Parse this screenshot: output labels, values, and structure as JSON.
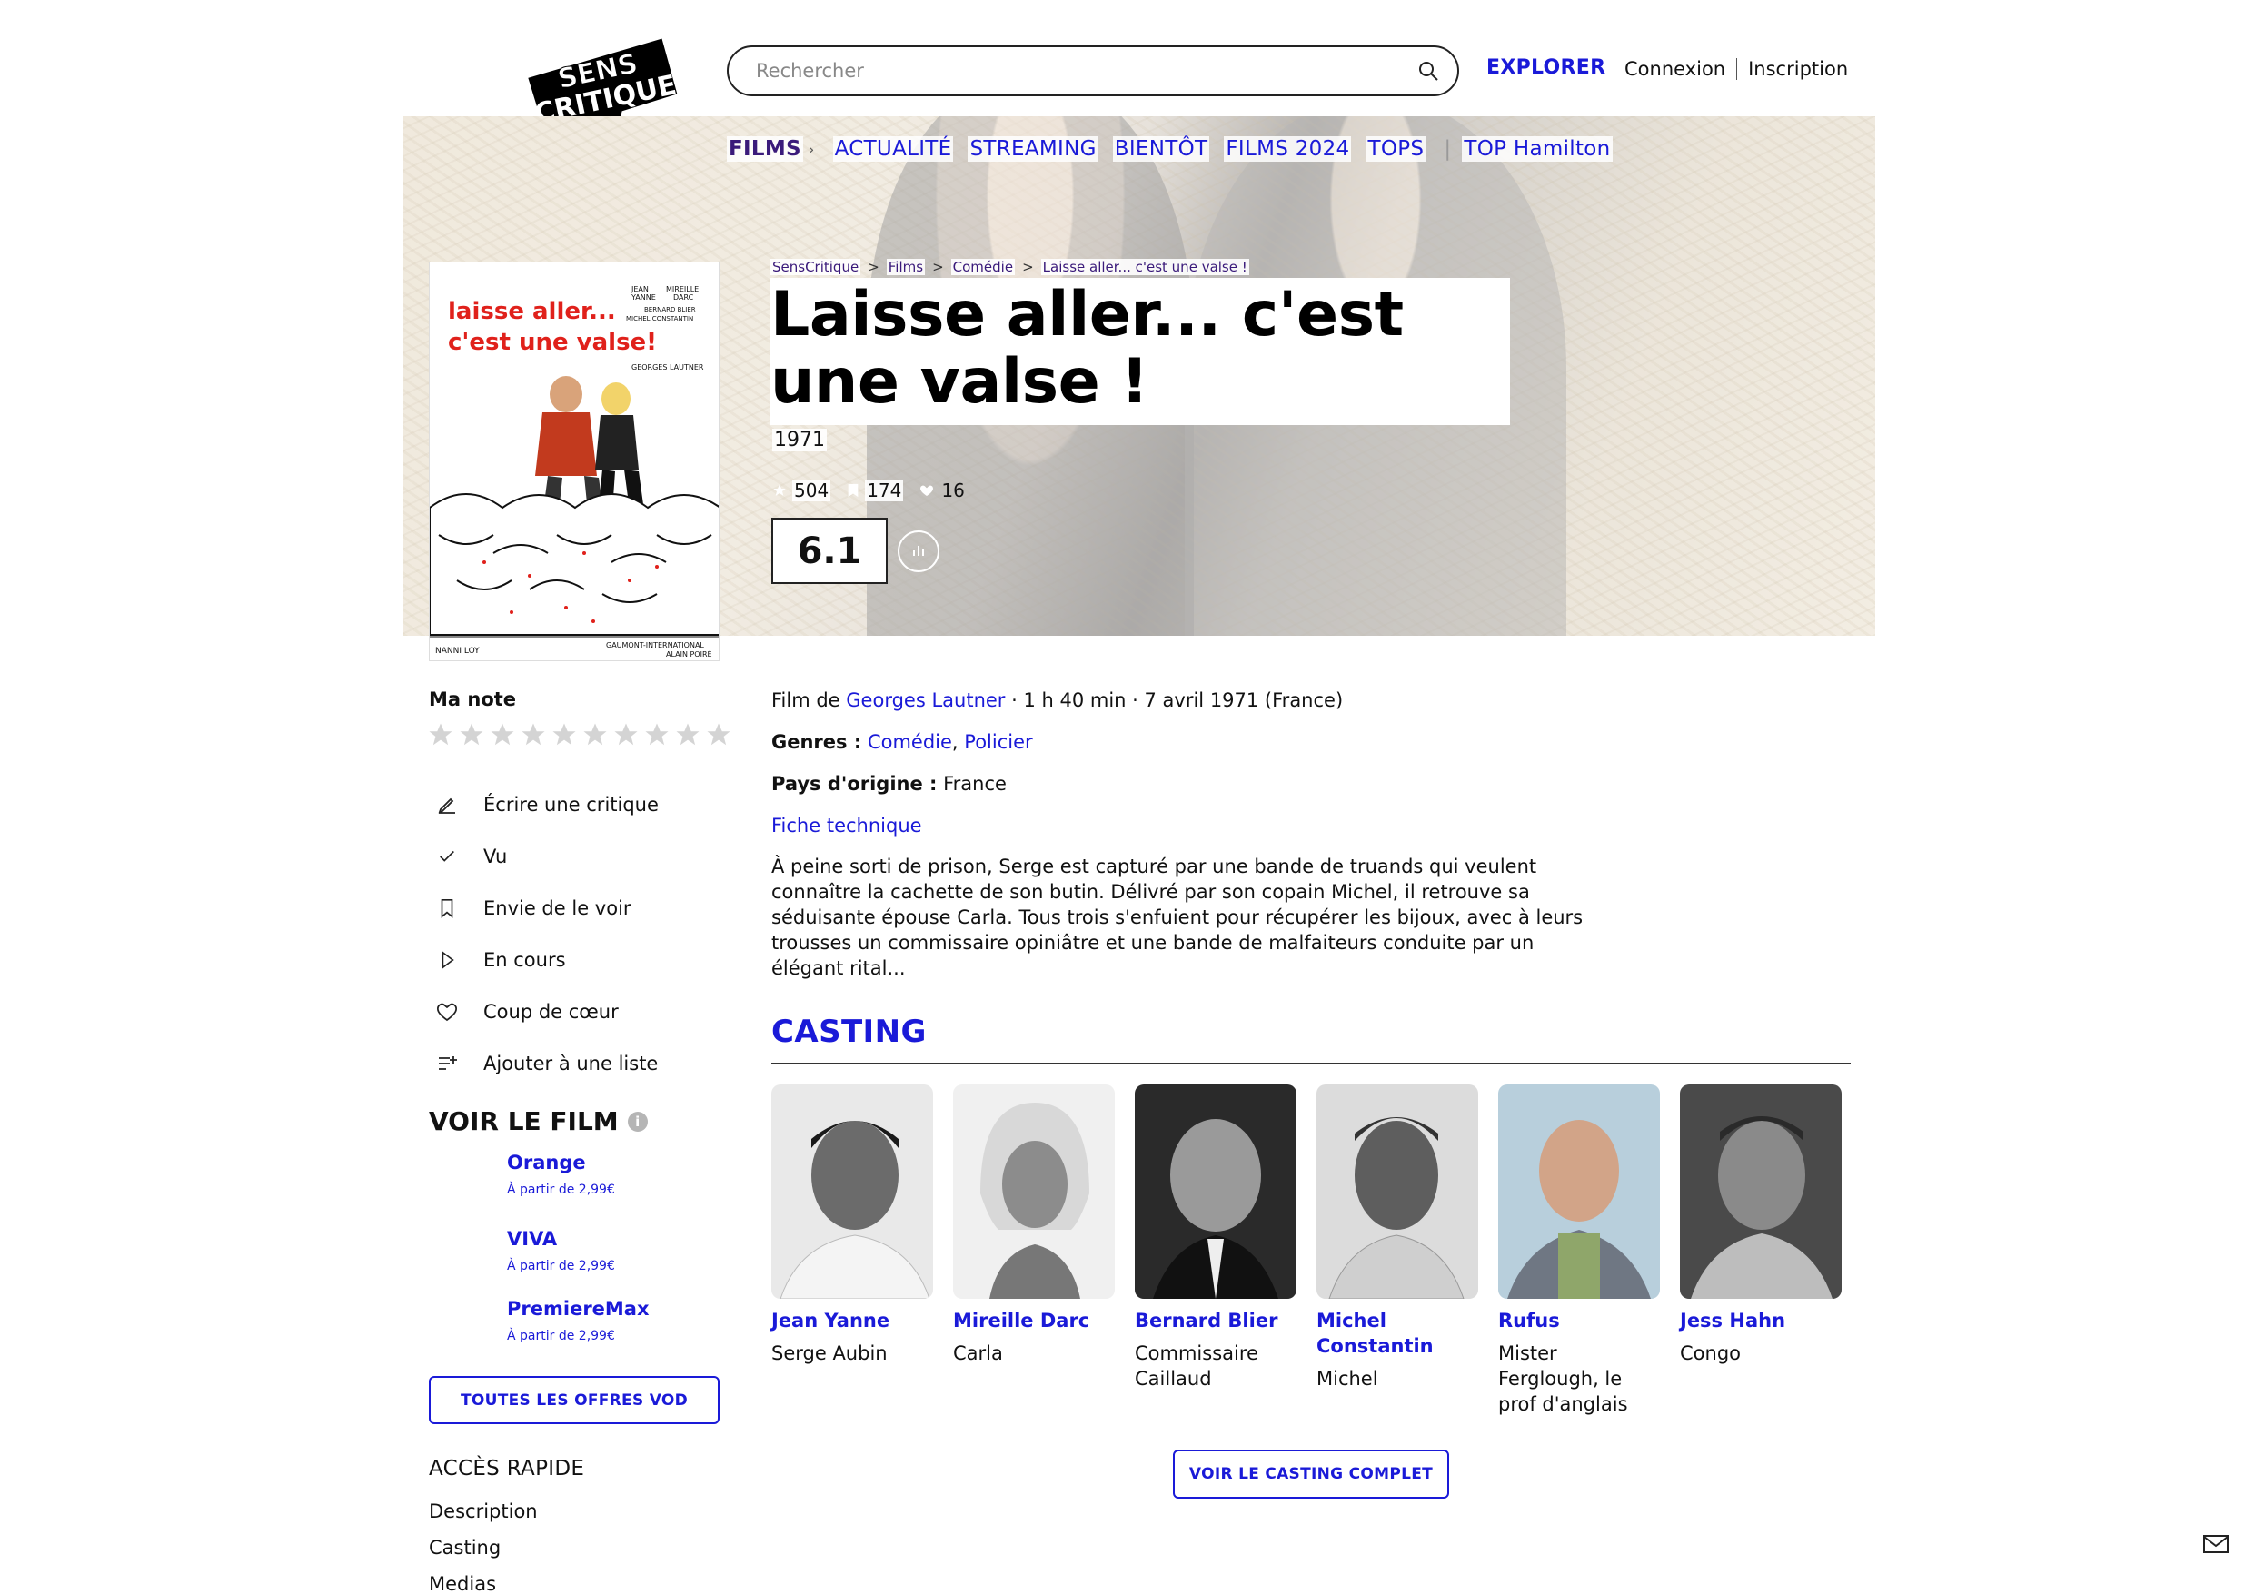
{
  "header": {
    "logo_line1": "SENS",
    "logo_line2": "CRITIQUE",
    "search_placeholder": "Rechercher",
    "explorer_label": "EXPLORER",
    "login_label": "Connexion",
    "signup_label": "Inscription"
  },
  "nav": {
    "films": "FILMS",
    "items": [
      "ACTUALITÉ",
      "STREAMING",
      "BIENTÔT",
      "FILMS 2024",
      "TOPS"
    ],
    "top_label": "TOP Hamilton"
  },
  "breadcrumb": [
    "SensCritique",
    "Films",
    "Comédie",
    "Laisse aller... c'est une valse !"
  ],
  "movie": {
    "title": "Laisse aller... c'est une valse !",
    "year": "1971",
    "ratings_count": "504",
    "wishlist_count": "174",
    "favorites_count": "16",
    "score": "6.1"
  },
  "poster": {
    "title_line1": "laisse aller...",
    "title_line2": "c'est une valse!",
    "credits_right": [
      "JEAN",
      "YANNE",
      "MIREILLE",
      "DARC",
      "BERNARD BLIER",
      "MICHEL CONSTANTIN"
    ],
    "director": "GEORGES LAUTNER",
    "bottom_left": "NANNI LOY",
    "bottom_right1": "GAUMONT-INTERNATIONAL",
    "bottom_right2": "ALAIN POIRÉ"
  },
  "my_rating": {
    "label": "Ma note",
    "stars": 10
  },
  "actions": [
    "Écrire une critique",
    "Vu",
    "Envie de le voir",
    "En cours",
    "Coup de cœur",
    "Ajouter à une liste"
  ],
  "watch": {
    "title": "VOIR LE FILM",
    "info": "i",
    "offers": [
      {
        "name": "Orange",
        "price": "À partir de 2,99€"
      },
      {
        "name": "VIVA",
        "price": "À partir de 2,99€"
      },
      {
        "name": "PremiereMax",
        "price": "À partir de 2,99€"
      }
    ],
    "all_offers_label": "TOUTES LES OFFRES VOD"
  },
  "quick_access": {
    "title": "ACCÈS RAPIDE",
    "items": [
      "Description",
      "Casting",
      "Medias"
    ]
  },
  "details": {
    "film_by_prefix": "Film de ",
    "director": "Georges Lautner",
    "runtime_date": " · 1 h 40 min · 7 avril 1971 (France)",
    "genres_label": "Genres :",
    "genre1": "Comédie",
    "genre_sep": ",",
    "genre2": "Policier",
    "country_label": "Pays d'origine :",
    "country": "France",
    "tech_sheet": "Fiche technique",
    "synopsis": "À peine sorti de prison, Serge est capturé par une bande de truands qui veulent connaître la cachette de son butin. Délivré par son copain Michel, il retrouve sa séduisante épouse Carla. Tous trois s'enfuient pour récupérer les bijoux, avec à leurs trousses un commissaire opiniâtre et une bande de malfaiteurs conduite par un élégant rital..."
  },
  "casting": {
    "title": "CASTING",
    "members": [
      {
        "actor": "Jean Yanne",
        "role": "Serge Aubin"
      },
      {
        "actor": "Mireille Darc",
        "role": "Carla"
      },
      {
        "actor": "Bernard Blier",
        "role": "Commissaire Caillaud"
      },
      {
        "actor": "Michel Constantin",
        "role": "Michel"
      },
      {
        "actor": "Rufus",
        "role": "Mister Ferglough, le prof d'anglais"
      },
      {
        "actor": "Jess Hahn",
        "role": "Congo"
      }
    ],
    "full_cast_label": "VOIR LE CASTING COMPLET"
  }
}
